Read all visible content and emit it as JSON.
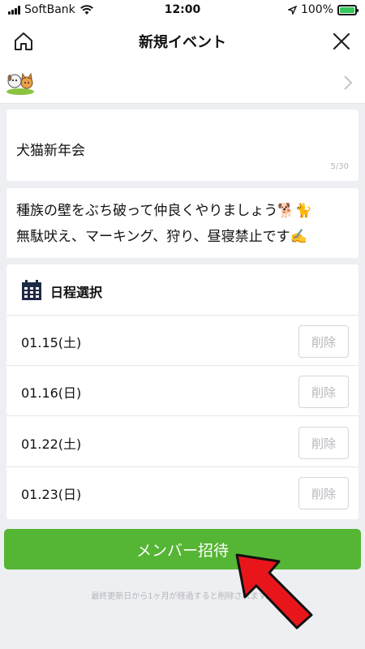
{
  "status": {
    "carrier": "SoftBank",
    "time": "12:00",
    "battery": "100%"
  },
  "nav": {
    "title": "新規イベント"
  },
  "event": {
    "title": "犬猫新年会",
    "title_counter": "5/30"
  },
  "description": {
    "line1": "種族の壁をぶち破って仲良くやりましょう🐕🐈",
    "line2": "無駄吠え、マーキング、狩り、昼寝禁止です✍️"
  },
  "schedule": {
    "header": "日程選択",
    "dates": [
      {
        "date": "01.15(土)",
        "delete_label": "削除"
      },
      {
        "date": "01.16(日)",
        "delete_label": "削除"
      },
      {
        "date": "01.22(土)",
        "delete_label": "削除"
      },
      {
        "date": "01.23(日)",
        "delete_label": "削除"
      }
    ]
  },
  "invite_button": "メンバー招待",
  "footer_note": "最終更新日から1ヶ月が経過すると削除されます。",
  "colors": {
    "accent_green": "#55b534",
    "annotation_red": "#e8161b"
  }
}
